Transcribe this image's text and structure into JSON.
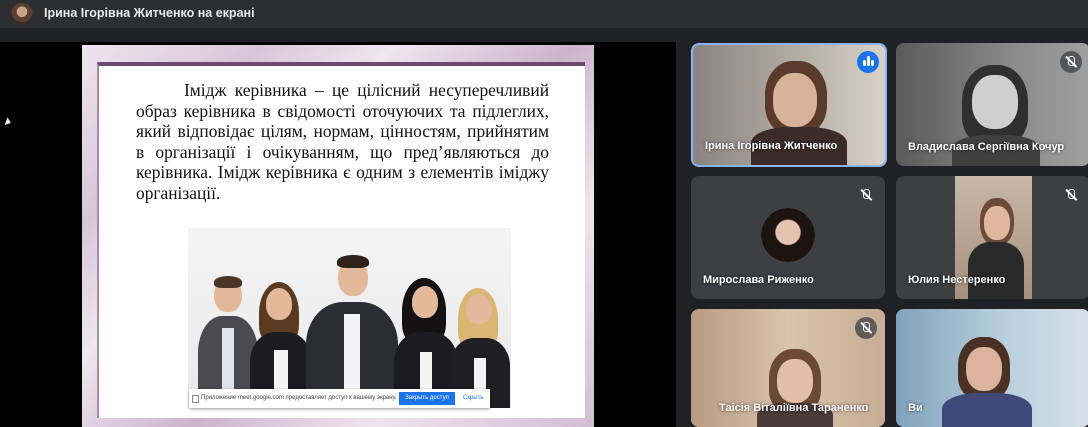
{
  "topbar": {
    "title": "Ірина Ігорівна Житченко на екрані",
    "avatar_icon": "presenter-avatar"
  },
  "slide": {
    "text": "Імідж керівника – це цілісний несуперечливий образ керівника в свідомості оточуючих та підлеглих, який відповідає цілям, нормам, цінностям, прийнятим в організації і очікуванням, що пред’являються до керівника. Імідж керівника є одним з елементів іміджу організації."
  },
  "share_notice": {
    "text": "Приложение meet.google.com предоставляет доступ к вашему экрану.",
    "stop_label": "Закрыть доступ",
    "hide_label": "Скрыть"
  },
  "participants": [
    {
      "name": "Ірина Ігорівна Житченко",
      "status": "speaking"
    },
    {
      "name": "Владислава Сергіївна Кочур",
      "status": "muted"
    },
    {
      "name": "Мирослава Риженко",
      "status": "muted"
    },
    {
      "name": "Юлия Нестеренко",
      "status": "muted"
    },
    {
      "name": "Таісія Віталіївна Тараненко",
      "status": "muted"
    },
    {
      "name": "Ви",
      "status": ""
    }
  ],
  "colors": {
    "accent": "#1a73e8",
    "background": "#202124",
    "slide_border": "#6b4a6e"
  }
}
